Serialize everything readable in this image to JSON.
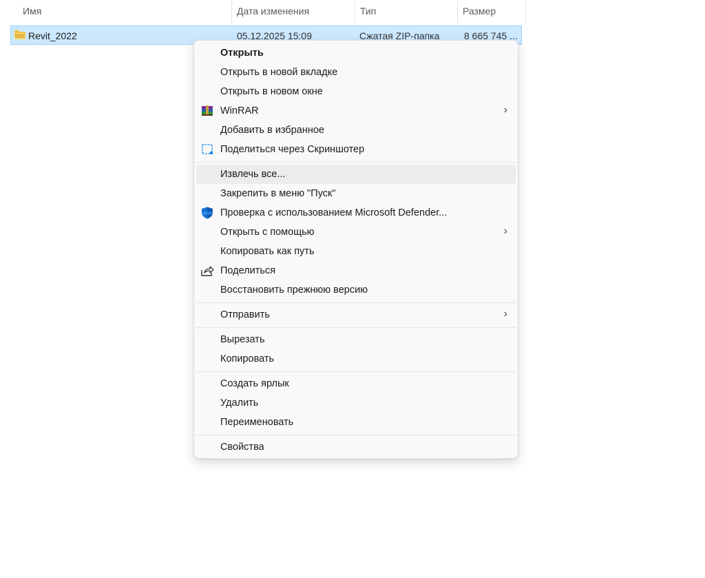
{
  "columns": {
    "name": "Имя",
    "modified": "Дата изменения",
    "type": "Тип",
    "size": "Размер"
  },
  "file": {
    "name": "Revit_2022",
    "modified": "05.12.2025 15:09",
    "type": "Сжатая ZIP-папка",
    "size": "8 665 745 ...",
    "icon": "zip-folder-icon"
  },
  "menu": {
    "open": "Открыть",
    "open_new_tab": "Открыть в новой вкладке",
    "open_new_window": "Открыть в новом окне",
    "winrar": "WinRAR",
    "add_favorites": "Добавить в избранное",
    "share_screenshoter": "Поделиться через Скриншотер",
    "extract_all": "Извлечь все...",
    "pin_start": "Закрепить в меню \"Пуск\"",
    "defender_scan": "Проверка с использованием Microsoft Defender...",
    "open_with": "Открыть с помощью",
    "copy_as_path": "Копировать как путь",
    "share": "Поделиться",
    "restore_previous": "Восстановить прежнюю версию",
    "send_to": "Отправить",
    "cut": "Вырезать",
    "copy": "Копировать",
    "create_shortcut": "Создать ярлык",
    "delete": "Удалить",
    "rename": "Переименовать",
    "properties": "Свойства",
    "submenu_arrow": "›"
  },
  "colors": {
    "selection_bg": "#cce8ff",
    "selection_border": "#99d1ff",
    "menu_bg": "#f9f9f9",
    "hover_bg": "#ececec",
    "defender_blue": "#1a73d9"
  }
}
